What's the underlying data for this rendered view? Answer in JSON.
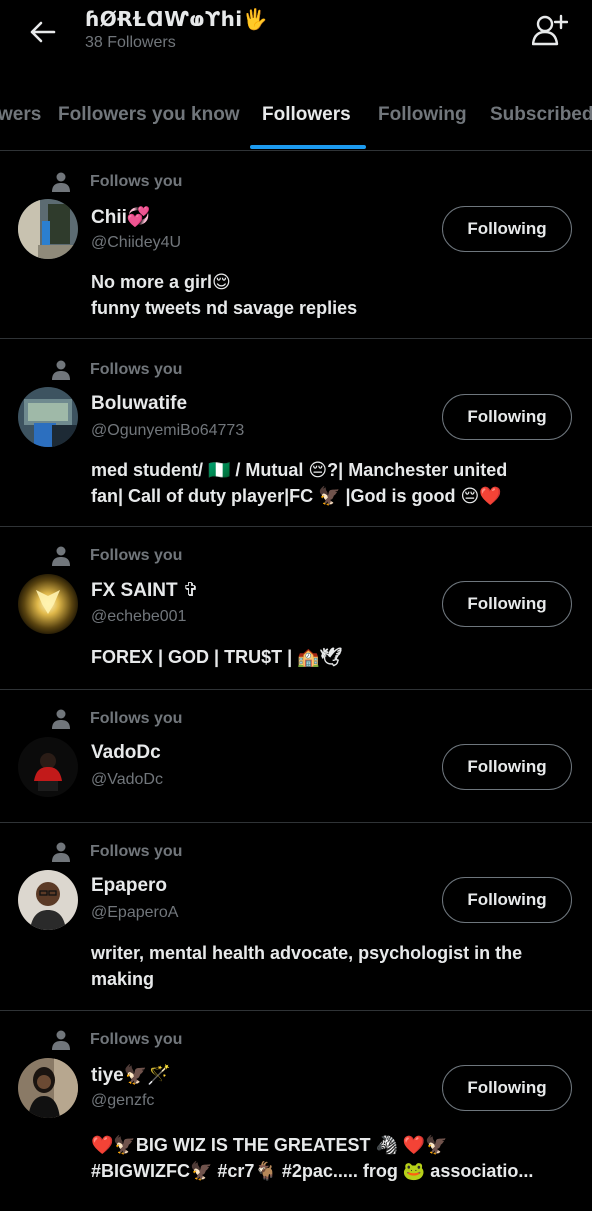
{
  "header": {
    "title": "ɦØɌⱢⱭⱲⱷϒhi🖐",
    "followers_count": "38 Followers"
  },
  "tabs": [
    {
      "label": "wers",
      "active": false
    },
    {
      "label": "Followers you know",
      "active": false
    },
    {
      "label": "Followers",
      "active": true
    },
    {
      "label": "Following",
      "active": false
    },
    {
      "label": "Subscribed",
      "active": false
    }
  ],
  "colors": {
    "background": "#000000",
    "accent": "#1d9bf0",
    "text_primary": "#e7e9ea",
    "text_secondary": "#71767b",
    "divider": "#2f3336"
  },
  "icons": {
    "back": "arrow-left-icon",
    "add_user": "person-plus-icon",
    "follows_you": "person-icon"
  },
  "users": [
    {
      "follows_label": "Follows you",
      "name": "Chii💞",
      "handle": "@Chiidey4U",
      "button_label": "Following",
      "bio_lines": [
        "No more a girl😌",
        "funny tweets nd savage replies"
      ]
    },
    {
      "follows_label": "Follows you",
      "name": "Boluwatife",
      "handle": "@OgunyemiBo64773",
      "button_label": "Following",
      "bio_lines": [
        "med student/ 🇳🇬 / Mutual 😔?| Manchester united",
        "fan| Call of duty player|FC 🦅 |God is good 😔❤️"
      ]
    },
    {
      "follows_label": "Follows you",
      "name": "FX SAINT ✞",
      "handle": "@echebe001",
      "button_label": "Following",
      "bio_lines": [
        "FOREX | GOD | TRU$T | 🏫🕊"
      ]
    },
    {
      "follows_label": "Follows you",
      "name": "VadoDc",
      "handle": "@VadoDc",
      "button_label": "Following",
      "bio_lines": []
    },
    {
      "follows_label": "Follows you",
      "name": "Epapero",
      "handle": "@EpaperoA",
      "button_label": "Following",
      "bio_lines": [
        "writer, mental health advocate, psychologist in the",
        "making"
      ]
    },
    {
      "follows_label": "Follows you",
      "name": "tiye🦅🪄",
      "handle": "@genzfc",
      "button_label": "Following",
      "bio_lines": [
        "❤️🦅BIG WIZ IS THE GREATEST 🦓 ❤️🦅",
        "#BIGWIZFC🦅 #cr7🐐 #2pac..... frog 🐸 associatio..."
      ]
    }
  ]
}
